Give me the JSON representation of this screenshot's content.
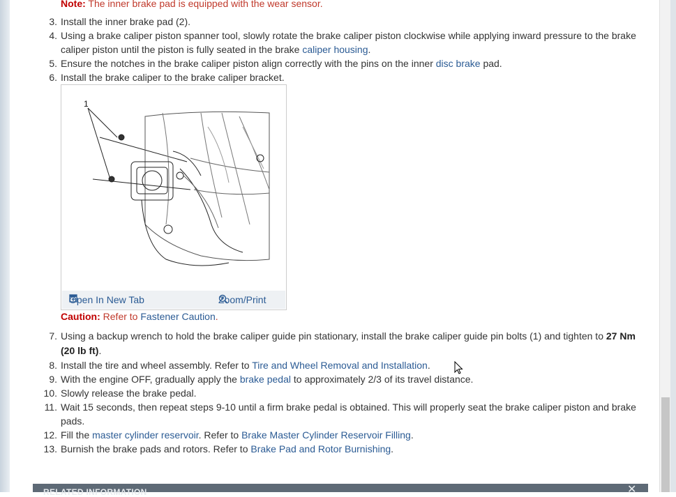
{
  "note": {
    "label": "Note:",
    "text": " The inner brake pad is equipped with the wear sensor."
  },
  "steps": [
    {
      "num": "3.",
      "lines": [
        [
          "Install the inner brake pad (2)."
        ]
      ]
    },
    {
      "num": "4.",
      "text1": "Using a brake caliper piston spanner tool, slowly rotate the brake caliper piston clockwise while applying inward pressure to the brake",
      "text2a": "caliper piston until the piston is fully seated in the brake ",
      "link": "caliper housing",
      "text2b": "."
    },
    {
      "num": "5.",
      "text1a": "Ensure the notches in the brake caliper piston align correctly with the pins on the inner ",
      "link": "disc brake",
      "text1b": " pad."
    },
    {
      "num": "6.",
      "text1": "Install the brake caliper to the brake caliper bracket."
    },
    {
      "num": "7.",
      "text1a": "Using a backup wrench to hold the brake caliper guide pin stationary, install the brake caliper guide pin bolts (1) and tighten to ",
      "bold1": "27 Nm",
      "bold2": "(20 lb ft)",
      "text2b": "."
    },
    {
      "num": "8.",
      "text1a": "Install the tire and wheel assembly. Refer to ",
      "link": "Tire and Wheel Removal and Installation",
      "text1b": "."
    },
    {
      "num": "9.",
      "text1a": "With the engine OFF, gradually apply the ",
      "link": "brake pedal",
      "text1b": " to approximately 2/3 of its travel distance."
    },
    {
      "num": "10.",
      "text1": "Slowly release the brake pedal."
    },
    {
      "num": "11.",
      "text1": "Wait 15 seconds, then repeat steps 9-10 until a firm brake pedal is obtained. This will properly seat the brake caliper piston and brake",
      "text2": "pads."
    },
    {
      "num": "12.",
      "text1a": "Fill the ",
      "link1": "master cylinder reservoir",
      "text1b": ". Refer to ",
      "link2": "Brake Master Cylinder Reservoir Filling",
      "text1c": "."
    },
    {
      "num": "13.",
      "text1a": "Burnish the brake pads and rotors. Refer to ",
      "link": "Brake Pad and Rotor Burnishing",
      "text1b": "."
    }
  ],
  "figure": {
    "callout": "1",
    "open_tab": "Open In New Tab",
    "zoom": "Zoom/Print"
  },
  "caution": {
    "label": "Caution:",
    "text": " Refer to ",
    "link": "Fastener Caution",
    "end": "."
  },
  "related": {
    "title": "RELATED INFORMATION",
    "close": "✕"
  }
}
